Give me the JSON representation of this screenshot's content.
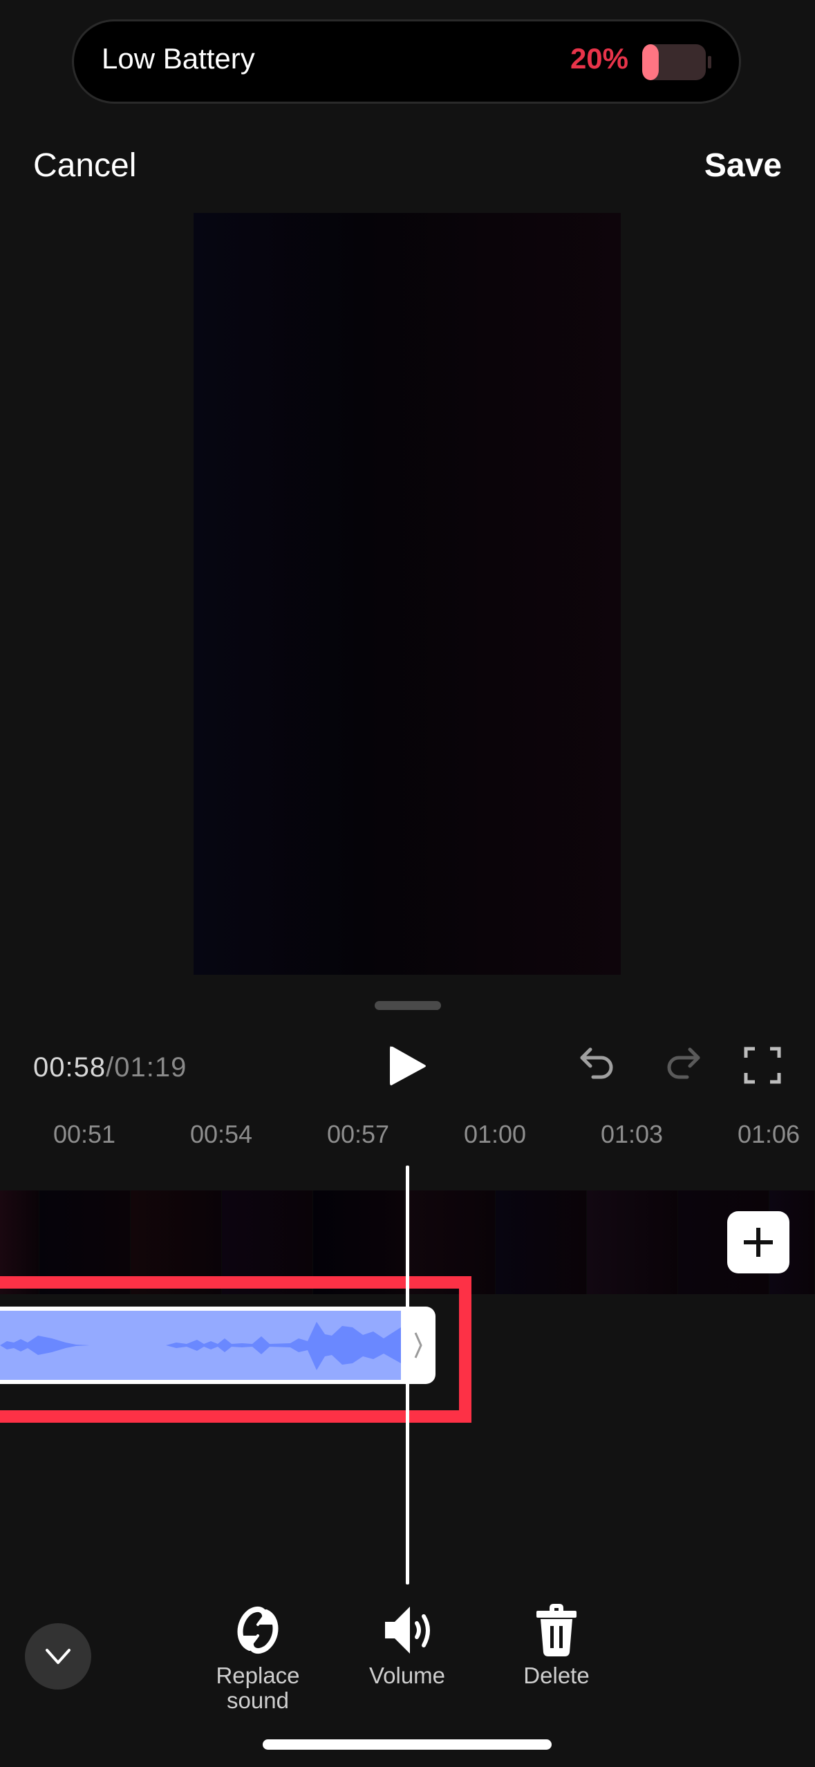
{
  "status": {
    "battery_label": "Low Battery",
    "battery_percent_text": "20%",
    "battery_level": 0.2,
    "battery_color": "#e8344a"
  },
  "header": {
    "cancel_label": "Cancel",
    "save_label": "Save"
  },
  "playback": {
    "current_time": "00:58",
    "separator": "/",
    "total_time": "01:19",
    "icons": {
      "play": "play-icon",
      "undo": "undo-icon",
      "redo": "redo-icon",
      "fullscreen": "fullscreen-icon"
    }
  },
  "timeline": {
    "ruler_ticks": [
      "00:51",
      "00:54",
      "00:57",
      "01:00",
      "01:03",
      "01:06"
    ],
    "add_clip_icon": "plus-icon",
    "audio_clip_color": "#94aaff",
    "waveform_color": "#6a88ff",
    "highlight_color": "#fd3146"
  },
  "toolbar": {
    "collapse_icon": "chevron-down-icon",
    "tools": [
      {
        "label": "Replace sound",
        "icon": "replace-sound-icon"
      },
      {
        "label": "Volume",
        "icon": "speaker-icon"
      },
      {
        "label": "Delete",
        "icon": "trash-icon"
      }
    ]
  }
}
